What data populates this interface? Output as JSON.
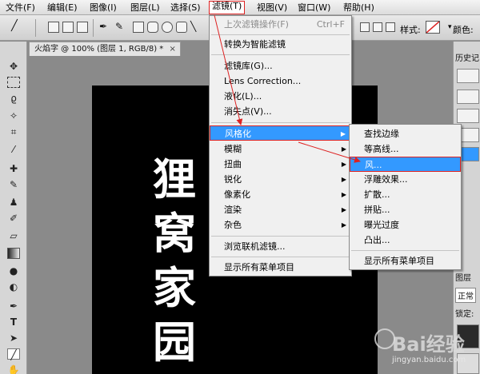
{
  "menubar": {
    "items": [
      "文件(F)",
      "编辑(E)",
      "图像(I)",
      "图层(L)",
      "选择(S)",
      "滤镜(T)",
      "视图(V)",
      "窗口(W)",
      "帮助(H)"
    ]
  },
  "options_bar": {
    "style_label": "样式:",
    "color_label": "颜色:"
  },
  "document": {
    "tab_title": "火焰字 @ 100% (图层 1, RGB/8) *",
    "close": "×",
    "canvas_text": [
      "狸",
      "窝",
      "家",
      "园"
    ]
  },
  "right_panel": {
    "history_tab": "历史记",
    "layers_tab": "图层",
    "blend_mode": "正常",
    "lock_label": "锁定:"
  },
  "filter_menu": {
    "last_filter": "上次滤镜操作(F)",
    "last_filter_shortcut": "Ctrl+F",
    "smart_filter": "转换为智能滤镜",
    "gallery": "滤镜库(G)...",
    "lens": "Lens Correction...",
    "liquify": "液化(L)...",
    "vanishing": "消失点(V)...",
    "stylize": "风格化",
    "blur": "模糊",
    "distort": "扭曲",
    "sharpen": "锐化",
    "pixelate": "像素化",
    "render": "渲染",
    "other": "杂色",
    "browse": "浏览联机滤镜...",
    "show_all": "显示所有菜单项目"
  },
  "stylize_menu": {
    "items": [
      "查找边缘",
      "等高线...",
      "风...",
      "浮雕效果...",
      "扩散...",
      "拼贴...",
      "曝光过度",
      "凸出..."
    ],
    "show_all": "显示所有菜单项目"
  },
  "watermark": {
    "text": "Bai经验",
    "url": "jingyan.baidu.com"
  },
  "colors": {
    "highlight": "#3399ff",
    "annotation": "#dd2222"
  }
}
